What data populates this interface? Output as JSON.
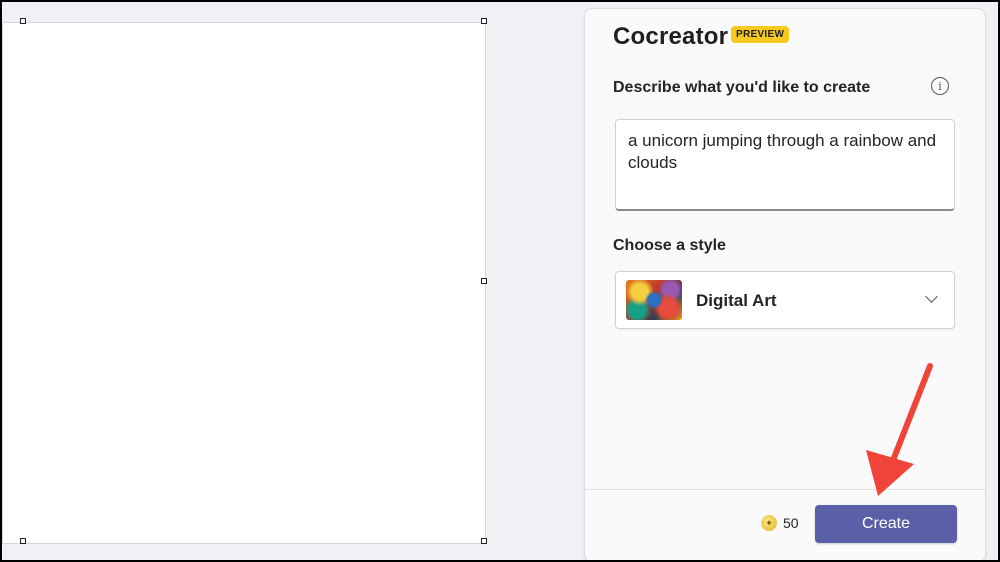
{
  "panel": {
    "title": "Cocreator",
    "badge": "PREVIEW",
    "describe_label": "Describe what you'd like to create",
    "info_icon": "info-icon",
    "prompt_value": "a unicorn jumping through a rainbow and clouds",
    "style_label": "Choose a style",
    "style_selected": "Digital Art",
    "credits": "50",
    "create_label": "Create"
  },
  "colors": {
    "accent": "#5b5fa8",
    "badge": "#f7c81e",
    "annotation_arrow": "#f0443a"
  }
}
